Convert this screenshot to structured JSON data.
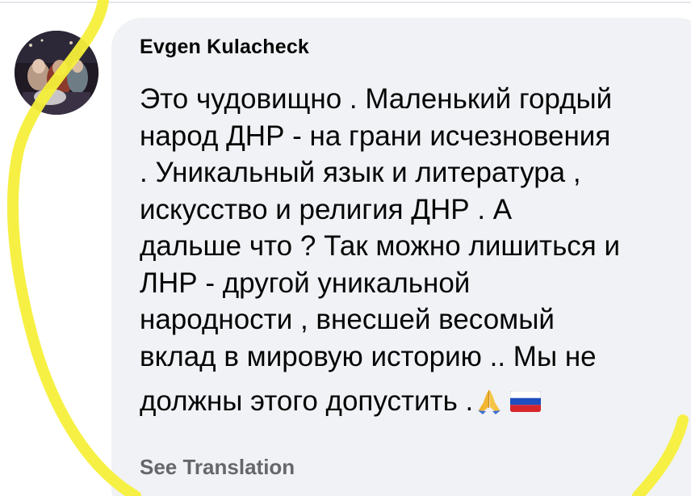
{
  "comment": {
    "author": "Evgen Kulacheck",
    "lines": [
      "Это чудовищно . Маленький гордый",
      "народ ДНР - на грани исчезновения",
      ". Уникальный язык и литература ,",
      "искусство и религия ДНР . А",
      "дальше что ? Так можно лишиться и",
      "ЛНР - другой уникальной",
      "народности , внесшей весомый",
      "вклад в мировую историю .. Мы не",
      "должны этого допустить ."
    ],
    "emojis": [
      "folded-hands-icon",
      "russia-flag-icon"
    ],
    "see_translation": "See Translation"
  },
  "colors": {
    "bubble": "#f0f2f5",
    "text": "#050505",
    "secondary_text": "#65676b",
    "highlighter": "#f5ef3a"
  }
}
